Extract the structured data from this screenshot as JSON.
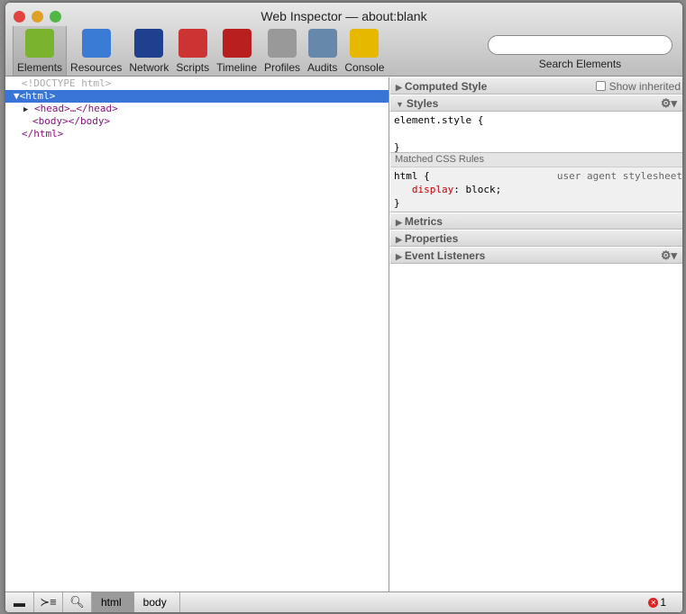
{
  "window": {
    "title": "Web Inspector — about:blank"
  },
  "toolbar": {
    "items": [
      {
        "label": "Elements",
        "icon": "elements-icon",
        "color": "#7ab32e"
      },
      {
        "label": "Resources",
        "icon": "resources-icon",
        "color": "#3a7bd5"
      },
      {
        "label": "Network",
        "icon": "network-icon",
        "color": "#1f3f8f"
      },
      {
        "label": "Scripts",
        "icon": "scripts-icon",
        "color": "#cc3333"
      },
      {
        "label": "Timeline",
        "icon": "timeline-icon",
        "color": "#b82020"
      },
      {
        "label": "Profiles",
        "icon": "profiles-icon",
        "color": "#999999"
      },
      {
        "label": "Audits",
        "icon": "audits-icon",
        "color": "#6688aa"
      },
      {
        "label": "Console",
        "icon": "console-icon",
        "color": "#e6b800"
      }
    ],
    "search_placeholder": "",
    "search_label": "Search Elements"
  },
  "dom": [
    "<!DOCTYPE html>",
    "<html>",
    "<head>…</head>",
    "<body></body>",
    "</html>"
  ],
  "sidebar": {
    "computed": "Computed Style",
    "show_inherited": "Show inherited",
    "styles": "Styles",
    "element_style_open": "element.style {",
    "close": "}",
    "matched": "Matched CSS Rules",
    "rule_selector": "html {",
    "rule_source": "user agent stylesheet",
    "rule_prop": "display",
    "rule_value": ": block;",
    "metrics": "Metrics",
    "properties": "Properties",
    "listeners": "Event Listeners"
  },
  "status": {
    "crumbs": [
      "html",
      "body"
    ],
    "errors": "1"
  }
}
